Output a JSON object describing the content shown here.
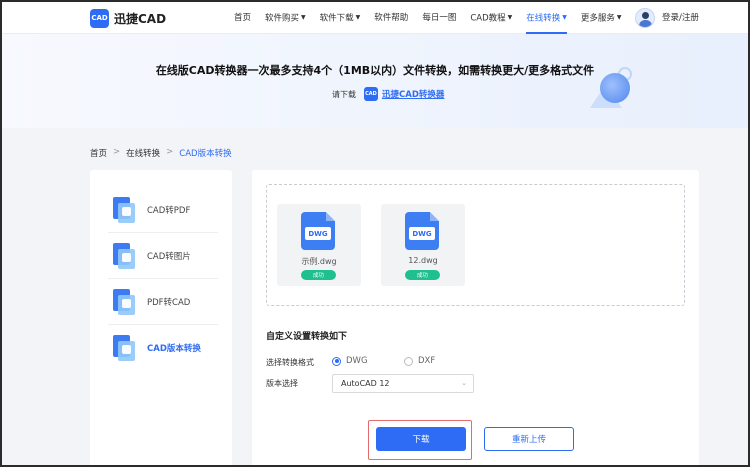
{
  "header": {
    "logo_badge": "CAD",
    "logo_text": "迅捷CAD",
    "nav": [
      {
        "label": "首页",
        "caret": false
      },
      {
        "label": "软件购买",
        "caret": true
      },
      {
        "label": "软件下载",
        "caret": true
      },
      {
        "label": "软件帮助",
        "caret": false
      },
      {
        "label": "每日一图",
        "caret": false
      },
      {
        "label": "CAD教程",
        "caret": true
      },
      {
        "label": "在线转换",
        "caret": true,
        "active": true
      },
      {
        "label": "更多服务",
        "caret": true
      }
    ],
    "login": "登录/注册",
    "accent": "#2e6cf5"
  },
  "banner": {
    "title": "在线版CAD转换器一次最多支持4个（1MB以内）文件转换，如需转换更大/更多格式文件",
    "sub_prefix": "请下载",
    "mini_badge": "CAD",
    "link": "迅捷CAD转换器"
  },
  "breadcrumb": {
    "items": [
      "首页",
      "在线转换",
      "CAD版本转换"
    ],
    "sep": ">"
  },
  "sidebar": {
    "items": [
      {
        "label": "CAD转PDF",
        "icon": "cad-to-pdf-icon",
        "active": false
      },
      {
        "label": "CAD转图片",
        "icon": "cad-to-image-icon",
        "active": false
      },
      {
        "label": "PDF转CAD",
        "icon": "pdf-to-cad-icon",
        "active": false
      },
      {
        "label": "CAD版本转换",
        "icon": "cad-version-icon",
        "active": true
      }
    ]
  },
  "files": [
    {
      "tag": "DWG",
      "name": "示例.dwg",
      "status": "成功"
    },
    {
      "tag": "DWG",
      "name": "12.dwg",
      "status": "成功"
    }
  ],
  "settings": {
    "title": "自定义设置转换如下",
    "format_label": "选择转换格式",
    "format_options": [
      {
        "label": "DWG",
        "checked": true
      },
      {
        "label": "DXF",
        "checked": false
      }
    ],
    "version_label": "版本选择",
    "version_value": "AutoCAD 12"
  },
  "actions": {
    "download": "下载",
    "reupload": "重新上传"
  },
  "colors": {
    "success": "#1fbf8f",
    "highlight_frame": "#e46b6b"
  }
}
